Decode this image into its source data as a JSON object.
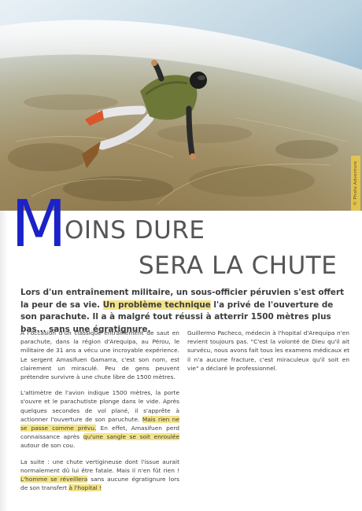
{
  "photo": {
    "credit": "© Photo Adventure",
    "colors": {
      "sky": "#8fb3c8",
      "ground": "#9a8a64",
      "vest": "#6f7a3a"
    }
  },
  "title": {
    "drop_letter": "M",
    "line1_rest": "OINS DURE",
    "line2": "SERA LA CHUTE",
    "drop_letter_color": "#1a22c8"
  },
  "lead": {
    "part1": "Lors d'un entraînement militaire, un sous-officier péruvien s'est offert la peur de sa vie.",
    "highlight": "Un problème technique",
    "part2": " l'a privé de l'ouverture de son parachute. Il a à malgré tout réussi à atterrir 1500 mètres plus bas... sans une égratignure.",
    "highlight_color": "#f4e48a"
  },
  "body": {
    "p1": "A l'occasion d'un classique entraînement de saut en parachute, dans la région d'Arequipa, au Pérou, le militaire de 31 ans a vécu une incroyable expérience. Le sergent Amasifuen Gamarra, c'est son nom, est clairement un miraculé. Peu de gens peuvent prétendre survivre à une chute libre de 1500 mètres.",
    "p2_a": "L'altimètre de l'avion indique 1500 mètres, la porte s'ouvre et le parachutiste plonge dans le vide. Après quelques secondes de vol plané, il s'apprête à actionner l'ouverture de son paruchute. ",
    "p2_hl1": "Mais rien ne se passe comme prévu.",
    "p2_b": " En effet, Amasifuen perd connaissance après ",
    "p2_hl2": "qu'une sangle se soit enroulée",
    "p2_c": " autour de son cou.",
    "p3_a": "La suite : une chute vertigineuse dont l'issue aurait normalement dû lui être fatale. Mais il n'en fût rien ! ",
    "p3_hl1": "L'homme se réveillera",
    "p3_b": " sans aucune égratignure lors de son transfert ",
    "p3_hl2": "à l'hopital !",
    "p4": "Guillermo Pacheco, médecin à l'hopital d'Arequipa n'en revient toujours pas. \"C'est la volonté de Dieu qu'il ait survécu, nous avons fait tous les examens médicaux et il n'a aucune fracture, c'est miraculeux qu'il soit en vie\" a déclaré le professionnel."
  }
}
